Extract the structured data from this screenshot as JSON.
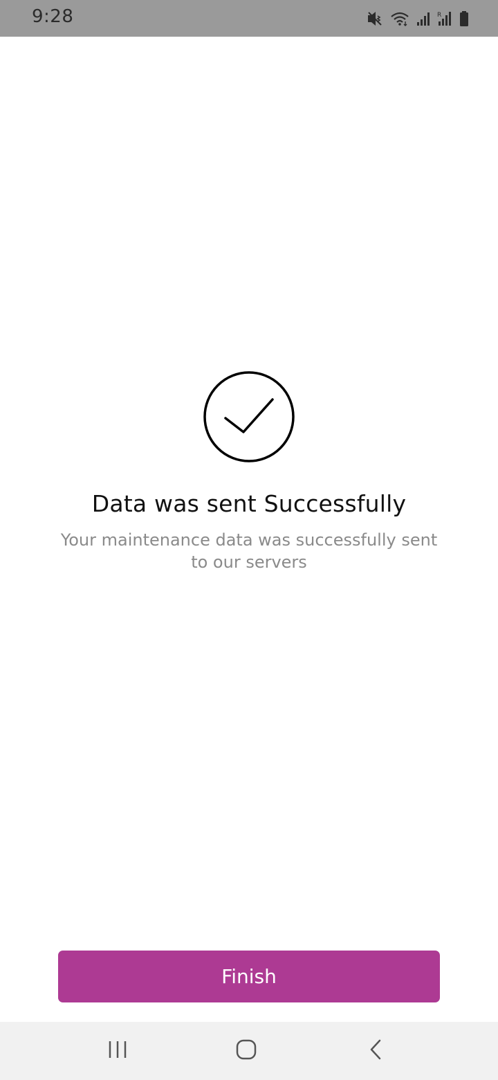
{
  "status_bar": {
    "time": "9:28",
    "icons": [
      "mute-vibrate-icon",
      "wifi-icon",
      "signal-icon",
      "signal-roaming-icon",
      "battery-icon"
    ]
  },
  "success": {
    "icon": "check-circle-icon",
    "title": "Data was sent Successfully",
    "message_line1": "Your maintenance data was successfully sent",
    "message_line2": "to our servers"
  },
  "actions": {
    "finish_label": "Finish"
  },
  "nav_bar": {
    "buttons": [
      "recent-apps-icon",
      "home-icon",
      "back-icon"
    ]
  },
  "colors": {
    "accent": "#ad3a93",
    "status_bar": "#9a9a9a",
    "nav_bar": "#f1f1f1",
    "subtitle": "#8a8a8a"
  }
}
